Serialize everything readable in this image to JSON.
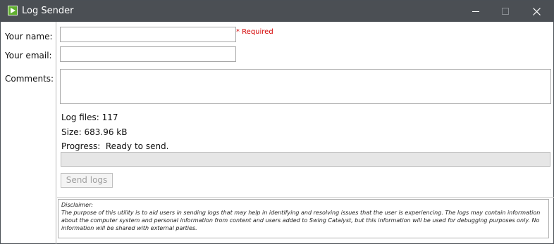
{
  "window": {
    "title": "Log Sender",
    "app_icon": "play-icon",
    "controls": {
      "minimize": "minimize-icon",
      "maximize": "maximize-icon",
      "close": "close-icon"
    }
  },
  "form": {
    "name_label": "Your name:",
    "name_value": "",
    "required_note": "* Required",
    "email_label": "Your email:",
    "email_value": "",
    "comments_label": "Comments:",
    "comments_value": ""
  },
  "info": {
    "log_files": "Log files: 117",
    "size": "Size: 683.96 kB",
    "progress": "Progress:  Ready to send.",
    "progress_fraction": 0
  },
  "actions": {
    "send_label": "Send logs"
  },
  "disclaimer": {
    "heading": "Disclaimer:",
    "body": "The purpose of this utility is to aid users in sending logs that may help in identifying and resolving issues that the user is experiencing. The logs may contain information about the computer system and personal information from content and users added to Swing Catalyst, but this information will be used for debugging purposes only. No information will be shared with external parties."
  },
  "colors": {
    "titlebar": "#4b4f54",
    "required": "#d40000",
    "app_icon": "#5fae2e"
  }
}
